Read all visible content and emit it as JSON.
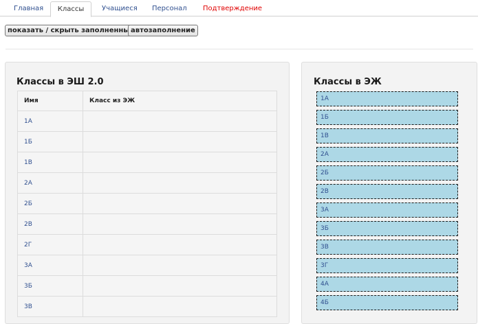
{
  "tabs": [
    {
      "label": "Главная"
    },
    {
      "label": "Классы"
    },
    {
      "label": "Учащиеся"
    },
    {
      "label": "Персонал"
    },
    {
      "label": "Подтверждение"
    }
  ],
  "toolbar": {
    "toggle_label": "показать / скрыть заполненные",
    "autofill_label": "автозаполнение"
  },
  "left_panel": {
    "title": "Классы в ЭШ 2.0",
    "columns": [
      "Имя",
      "Класс из ЭЖ"
    ],
    "rows": [
      {
        "name": "1А",
        "ej": ""
      },
      {
        "name": "1Б",
        "ej": ""
      },
      {
        "name": "1В",
        "ej": ""
      },
      {
        "name": "2А",
        "ej": ""
      },
      {
        "name": "2Б",
        "ej": ""
      },
      {
        "name": "2В",
        "ej": ""
      },
      {
        "name": "2Г",
        "ej": ""
      },
      {
        "name": "3А",
        "ej": ""
      },
      {
        "name": "3Б",
        "ej": ""
      },
      {
        "name": "3В",
        "ej": ""
      }
    ]
  },
  "right_panel": {
    "title": "Классы в ЭЖ",
    "items": [
      "1А",
      "1Б",
      "1В",
      "2А",
      "2Б",
      "2В",
      "3А",
      "3Б",
      "3В",
      "3Г",
      "4А",
      "4Б"
    ]
  },
  "colors": {
    "active_tab_border": "#cfcfcf",
    "alert_tab": "#e00000",
    "link": "#2f4f8f",
    "ej_item_bg": "#add8e6"
  }
}
